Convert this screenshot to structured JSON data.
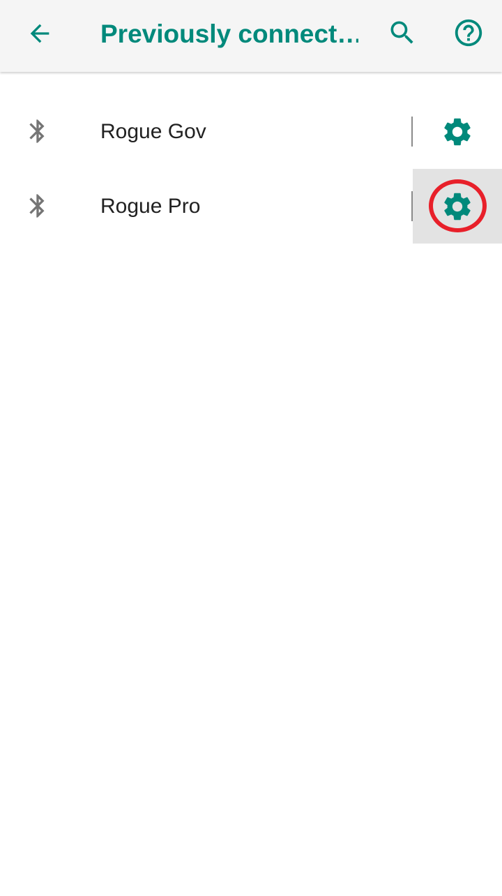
{
  "app_bar": {
    "title": "Previously connect…",
    "back_icon": "arrow-back-icon",
    "search_icon": "search-icon",
    "help_icon": "help-circle-icon",
    "accent_color": "#00897b"
  },
  "devices": [
    {
      "name": "Rogue Gov",
      "icon": "bluetooth-icon",
      "settings_icon": "gear-icon",
      "pressed": false
    },
    {
      "name": "Rogue Pro",
      "icon": "bluetooth-icon",
      "settings_icon": "gear-icon",
      "pressed": true
    }
  ],
  "annotation": {
    "highlight_color": "#e8202a"
  }
}
